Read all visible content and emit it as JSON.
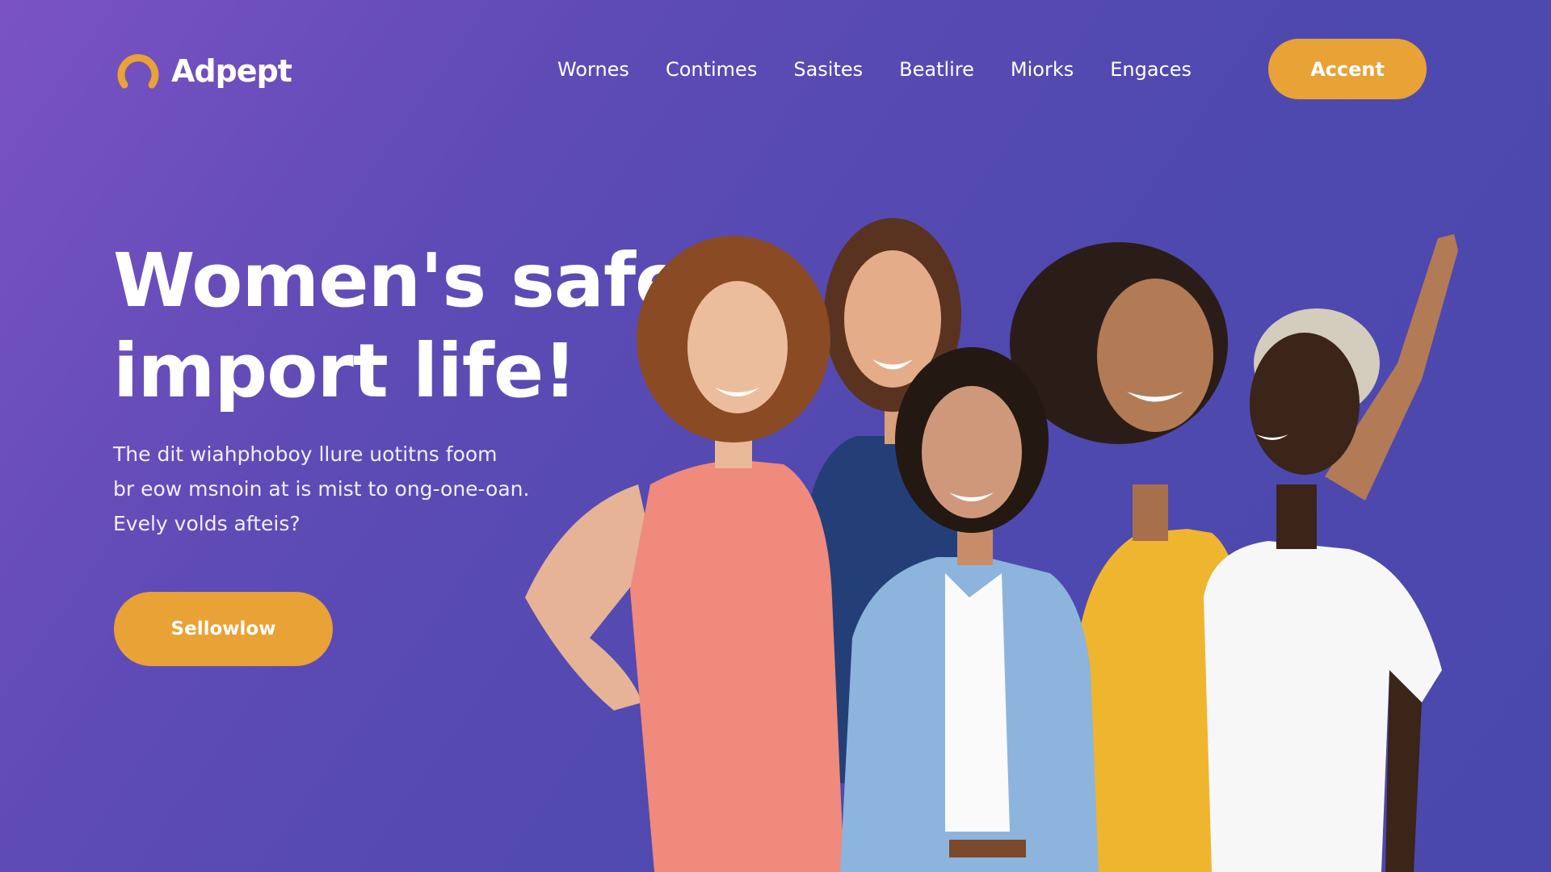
{
  "brand": {
    "name": "Adpept",
    "accent_color": "#e8a236",
    "background_gradient": [
      "#7a52c4",
      "#4a48ad"
    ]
  },
  "nav": {
    "links": [
      "Wornes",
      "Contimes",
      "Sasites",
      "Beatlire",
      "Miorks",
      "Engaces"
    ],
    "cta_label": "Accent"
  },
  "hero": {
    "title_lines": [
      "Women's safety,",
      "import life!"
    ],
    "subtitle_lines": [
      "The dit wiahphoboy llure uotitns foom",
      "br eow msnoin at is mist to ong-one-oan.",
      "Evely volds afteis?"
    ],
    "cta_label": "Sellowlow"
  },
  "photo": {
    "subject": "group of five smiling women",
    "shirt_colors": [
      "#ef8a7c",
      "#243f78",
      "#8db4dc",
      "#efb52e",
      "#f7f7f7"
    ]
  }
}
